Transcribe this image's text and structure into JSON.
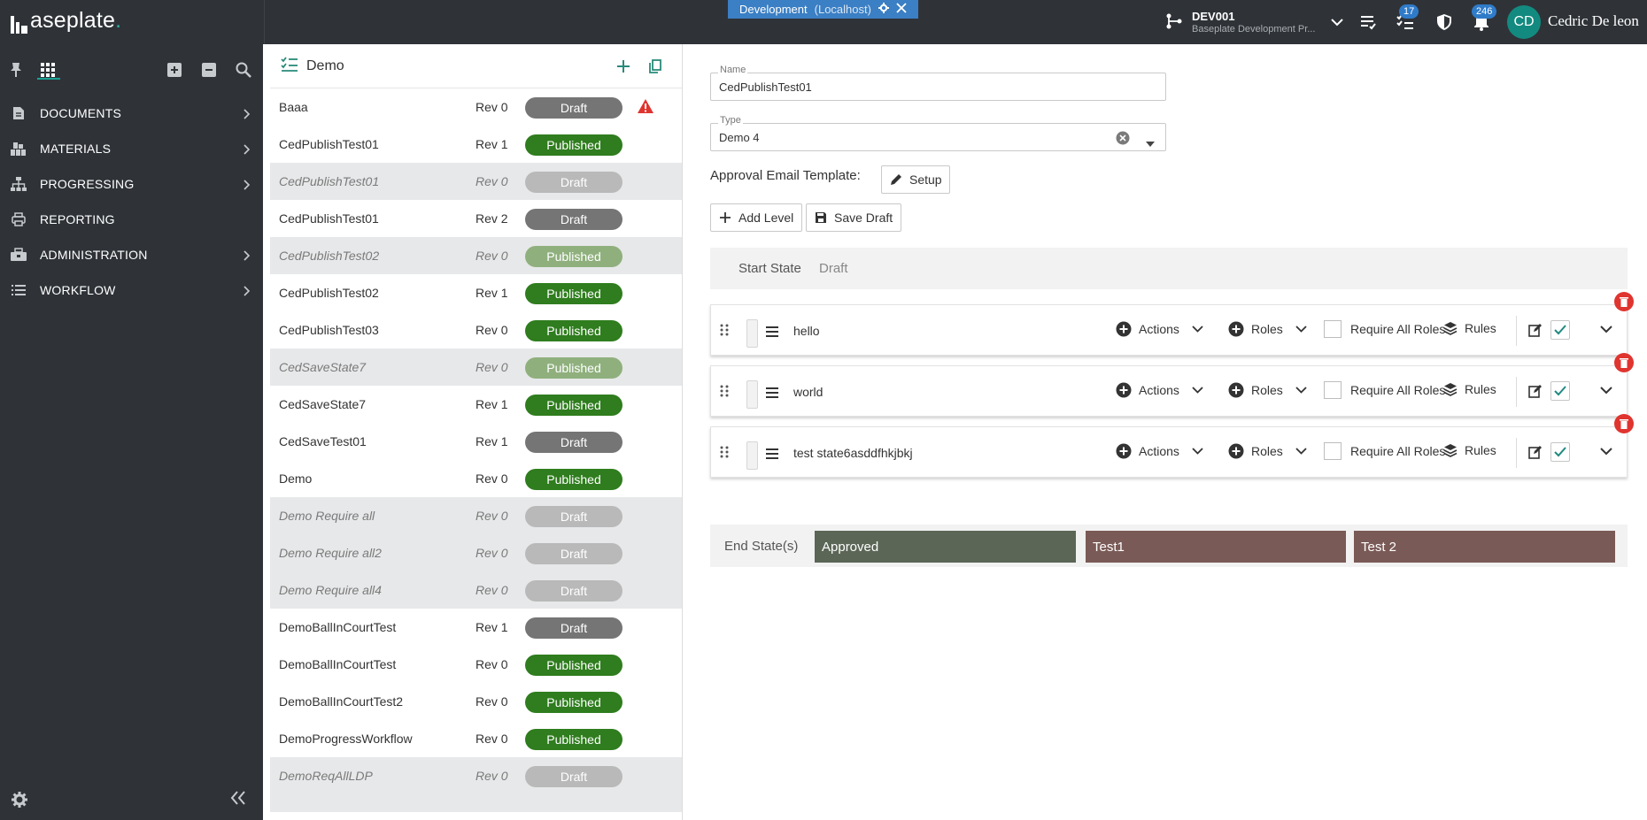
{
  "app": {
    "logo_text": "aseplate",
    "logo_dot": ".",
    "env_label": "Development",
    "env_sub": "(Localhost)"
  },
  "project": {
    "code": "DEV001",
    "subtitle": "Baseplate Development Pr..."
  },
  "topbar": {
    "tasks_badge": "17",
    "notifications_badge": "246",
    "avatar_initials": "CD",
    "user_name": "Cedric De leon"
  },
  "sidebar": {
    "items": [
      {
        "label": "DOCUMENTS",
        "icon": "document-icon"
      },
      {
        "label": "MATERIALS",
        "icon": "materials-icon"
      },
      {
        "label": "PROGRESSING",
        "icon": "hierarchy-icon"
      },
      {
        "label": "REPORTING",
        "icon": "printer-icon"
      },
      {
        "label": "ADMINISTRATION",
        "icon": "admin-icon"
      },
      {
        "label": "WORKFLOW",
        "icon": "list-icon"
      }
    ]
  },
  "list": {
    "title": "Demo",
    "rows": [
      {
        "name": "Baaa",
        "rev": "Rev 0",
        "status": "Draft",
        "inactive": false,
        "warning": true
      },
      {
        "name": "CedPublishTest01",
        "rev": "Rev 1",
        "status": "Published",
        "inactive": false
      },
      {
        "name": "CedPublishTest01",
        "rev": "Rev 0",
        "status": "Draft",
        "inactive": true
      },
      {
        "name": "CedPublishTest01",
        "rev": "Rev 2",
        "status": "Draft",
        "inactive": false
      },
      {
        "name": "CedPublishTest02",
        "rev": "Rev 0",
        "status": "Published",
        "inactive": true
      },
      {
        "name": "CedPublishTest02",
        "rev": "Rev 1",
        "status": "Published",
        "inactive": false
      },
      {
        "name": "CedPublishTest03",
        "rev": "Rev 0",
        "status": "Published",
        "inactive": false
      },
      {
        "name": "CedSaveState7",
        "rev": "Rev 0",
        "status": "Published",
        "inactive": true
      },
      {
        "name": "CedSaveState7",
        "rev": "Rev 1",
        "status": "Published",
        "inactive": false
      },
      {
        "name": "CedSaveTest01",
        "rev": "Rev 1",
        "status": "Draft",
        "inactive": false
      },
      {
        "name": "Demo",
        "rev": "Rev 0",
        "status": "Published",
        "inactive": false
      },
      {
        "name": "Demo Require all",
        "rev": "Rev 0",
        "status": "Draft",
        "inactive": true
      },
      {
        "name": "Demo Require all2",
        "rev": "Rev 0",
        "status": "Draft",
        "inactive": true
      },
      {
        "name": "Demo Require all4",
        "rev": "Rev 0",
        "status": "Draft",
        "inactive": true
      },
      {
        "name": "DemoBallInCourtTest",
        "rev": "Rev 1",
        "status": "Draft",
        "inactive": false
      },
      {
        "name": "DemoBallInCourtTest",
        "rev": "Rev 0",
        "status": "Published",
        "inactive": false
      },
      {
        "name": "DemoBallInCourtTest2",
        "rev": "Rev 0",
        "status": "Published",
        "inactive": false
      },
      {
        "name": "DemoProgressWorkflow",
        "rev": "Rev 0",
        "status": "Published",
        "inactive": false
      },
      {
        "name": "DemoReqAllLDP",
        "rev": "Rev 0",
        "status": "Draft",
        "inactive": true
      }
    ]
  },
  "editor": {
    "name_label": "Name",
    "name_value": "CedPublishTest01",
    "type_label": "Type",
    "type_value": "Demo 4",
    "approval_label": "Approval Email Template:",
    "setup_label": "Setup",
    "add_level_label": "Add Level",
    "save_draft_label": "Save Draft",
    "start_state_label": "Start State",
    "start_state_value": "Draft",
    "end_states_label": "End State(s)",
    "levels": [
      {
        "name": "hello"
      },
      {
        "name": "world"
      },
      {
        "name": "test state6asddfhkjbkj"
      }
    ],
    "level_labels": {
      "actions": "Actions",
      "roles": "Roles",
      "require_all": "Require All Roles",
      "rules": "Rules"
    },
    "end_states": [
      {
        "name": "Approved",
        "color": "#5b6656"
      },
      {
        "name": "Test1",
        "color": "#7a5a56"
      },
      {
        "name": "Test 2",
        "color": "#7a5a56"
      }
    ]
  }
}
